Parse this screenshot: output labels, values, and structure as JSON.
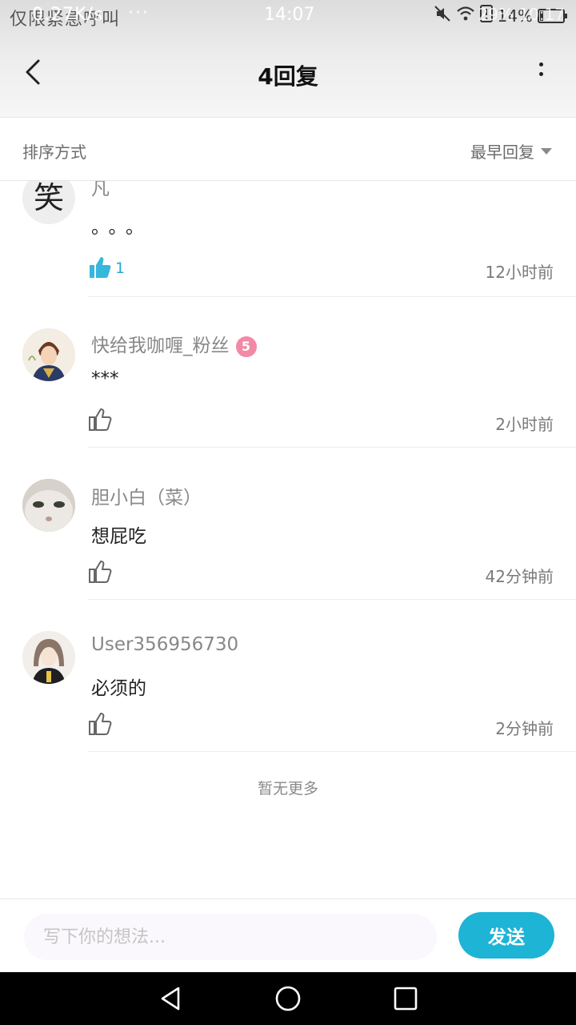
{
  "status_bar": {
    "left_text": "仅限紧急呼叫",
    "left_ghost": "0.27K/s",
    "dots": "···",
    "time": "14:07",
    "battery_text": "14%",
    "right_ghost": "29% 10:17",
    "battery_level": 0.14
  },
  "header": {
    "title": "4回复"
  },
  "sort": {
    "label": "排序方式",
    "value": "最早回复"
  },
  "comments": [
    {
      "username": "凡",
      "text": "。。。",
      "likes": "1",
      "time": "12小时前",
      "liked": true,
      "avatar": "笑"
    },
    {
      "username": "快给我咖喱_粉丝",
      "badge": "5",
      "text": "***",
      "likes": "",
      "time": "2小时前",
      "liked": false
    },
    {
      "username": "胆小白（菜）",
      "text": "想屁吃",
      "likes": "",
      "time": "42分钟前",
      "liked": false
    },
    {
      "username": "User356956730",
      "text": "必须的",
      "likes": "",
      "time": "2分钟前",
      "liked": false
    }
  ],
  "footer": {
    "no_more": "暂无更多"
  },
  "input_bar": {
    "placeholder": "写下你的想法...",
    "send_label": "发送"
  },
  "colors": {
    "accent": "#1db4d6",
    "like_active": "#2aa9cf",
    "badge": "#f28aa6"
  },
  "icons": [
    "back-arrow-icon",
    "more-vertical-icon",
    "caret-down-icon",
    "thumbs-up-icon",
    "nav-back-icon",
    "nav-home-icon",
    "nav-recents-icon"
  ]
}
